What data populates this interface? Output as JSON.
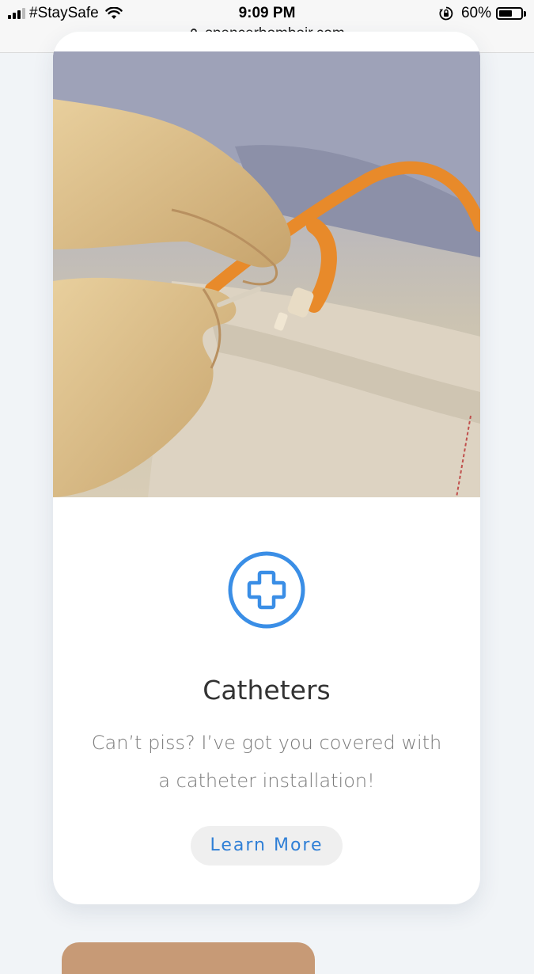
{
  "status_bar": {
    "carrier": "#StaySafe",
    "time": "9:09 PM",
    "battery_percent": "60%",
    "battery_level": 0.6,
    "icons": [
      "signal-icon",
      "wifi-icon",
      "orientation-lock-icon",
      "battery-icon"
    ]
  },
  "browser": {
    "url": "spencerbomboir.com",
    "icon": "padlock-icon"
  },
  "card": {
    "image": "catheter-photo",
    "icon": "plus-circle-icon",
    "title": "Catheters",
    "description_line1": "Can’t piss? I’ve got you covered with",
    "description_line2": "a catheter installation!",
    "button_label": "Learn More"
  },
  "colors": {
    "accent": "#2f7fd6",
    "button_bg": "#efefef",
    "page_bg": "#f1f4f7"
  }
}
